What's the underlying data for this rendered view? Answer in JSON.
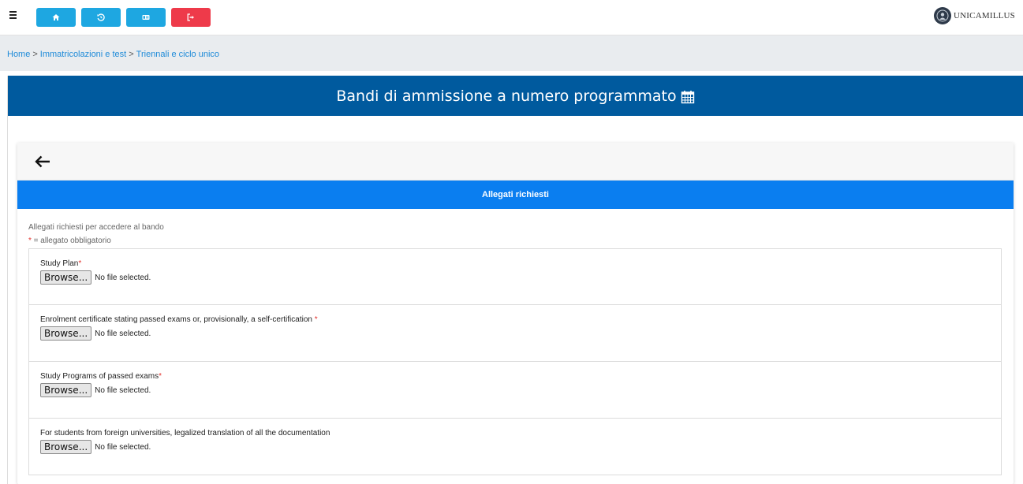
{
  "topbar": {
    "brand_text": "UNICAMILLUS",
    "buttons": [
      {
        "icon": "home-icon",
        "color": "#1ea7e1"
      },
      {
        "icon": "history-icon",
        "color": "#1ea7e1"
      },
      {
        "icon": "id-card-icon",
        "color": "#1ea7e1"
      },
      {
        "icon": "logout-icon",
        "color": "#ee3a4a"
      }
    ]
  },
  "breadcrumb": {
    "items": [
      "Home",
      "Immatricolazioni e test",
      "Triennali e ciclo unico"
    ],
    "separator": ">"
  },
  "banner": {
    "title": "Bandi di ammissione a numero programmato",
    "color": "#005a9e"
  },
  "card": {
    "section_title": "Allegati richiesti",
    "section_color": "#0a7ef0",
    "intro": "Allegati richiesti per accedere al bando",
    "legend_star": "*",
    "legend_text": " = allegato obbligatorio"
  },
  "attachments": [
    {
      "label": "Study Plan",
      "required_mark": "*",
      "browse_label": "Browse...",
      "status": "No file selected."
    },
    {
      "label": "Enrolment certificate stating passed exams or, provisionally, a self-certification ",
      "required_mark": "*",
      "browse_label": "Browse...",
      "status": "No file selected."
    },
    {
      "label": "Study Programs of passed exams",
      "required_mark": "*",
      "browse_label": "Browse...",
      "status": "No file selected."
    },
    {
      "label": "For students from foreign universities, legalized translation of all the documentation",
      "required_mark": "",
      "browse_label": "Browse...",
      "status": "No file selected."
    }
  ]
}
